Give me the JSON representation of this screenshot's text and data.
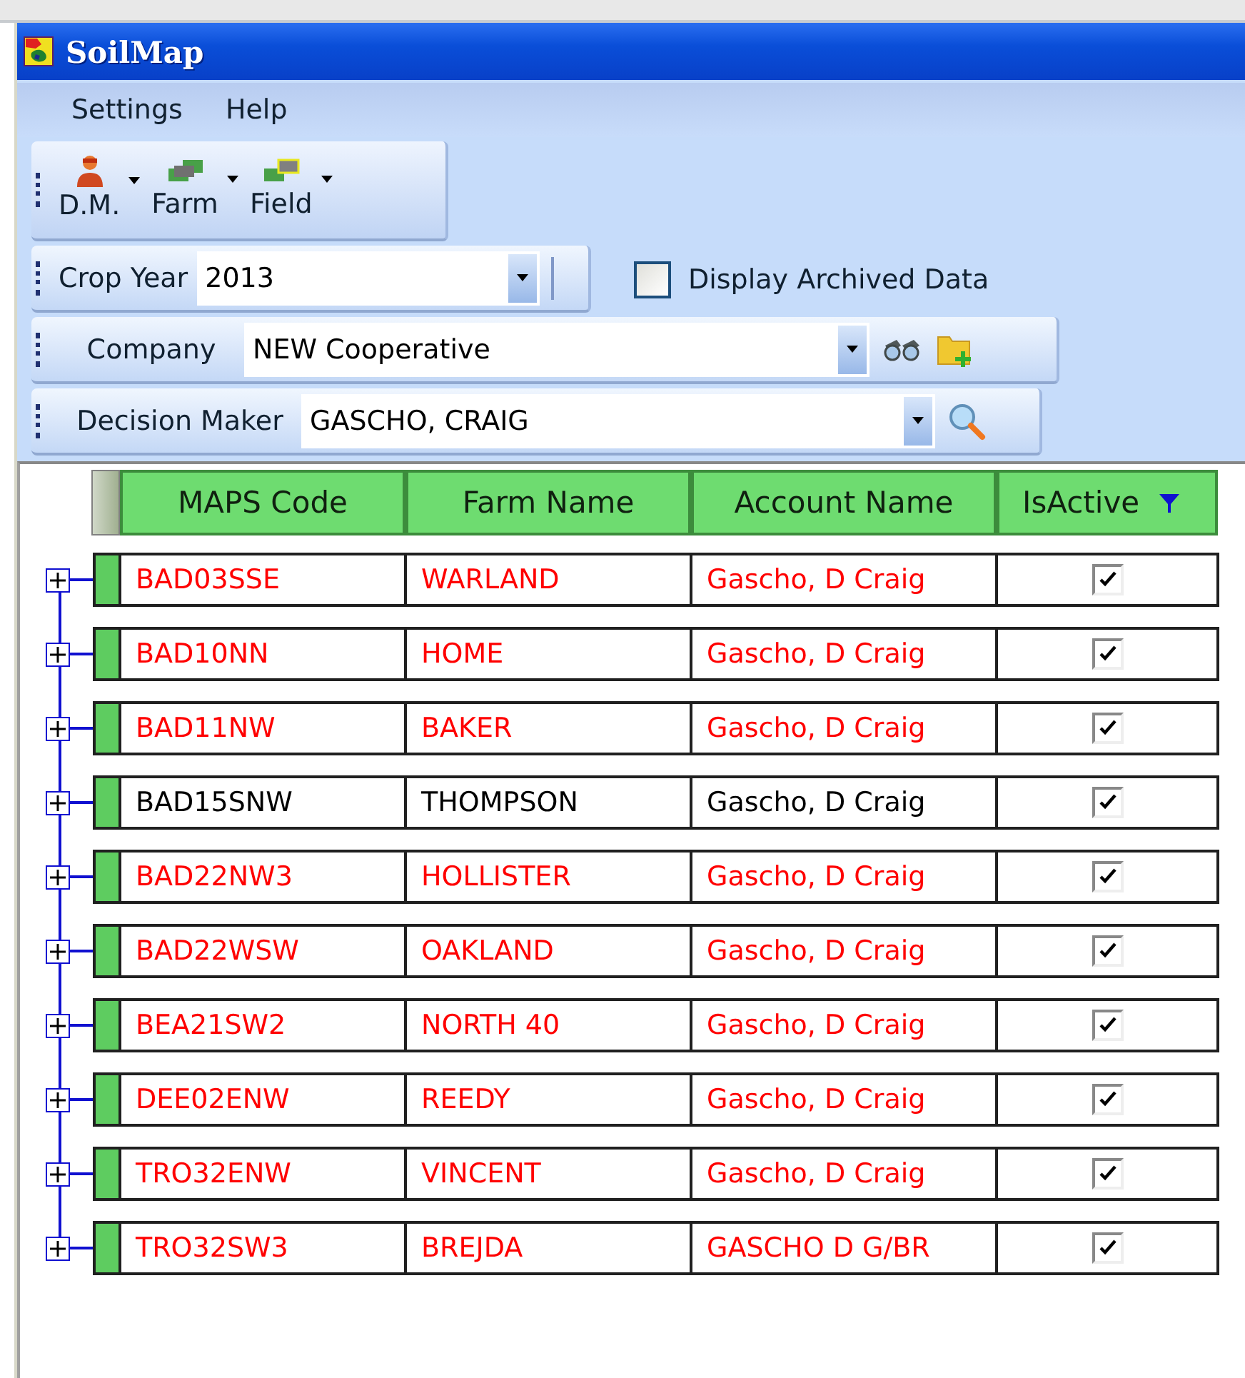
{
  "window": {
    "title": "SoilMap"
  },
  "menu": [
    "Settings",
    "Help"
  ],
  "toolbar": [
    {
      "label": "D.M.",
      "kind": "person"
    },
    {
      "label": "Farm",
      "kind": "farm"
    },
    {
      "label": "Field",
      "kind": "field"
    }
  ],
  "crop_year": {
    "label": "Crop Year",
    "value": "2013"
  },
  "archived": {
    "label": "Display Archived Data",
    "checked": false
  },
  "company": {
    "label": "Company",
    "value": "NEW Cooperative"
  },
  "decision_maker": {
    "label": "Decision Maker",
    "value": "GASCHO, CRAIG"
  },
  "table": {
    "columns": [
      "MAPS Code",
      "Farm Name",
      "Account Name",
      "IsActive"
    ],
    "rows": [
      {
        "cells": [
          "BAD03SSE",
          "WARLAND",
          "Gascho, D Craig"
        ],
        "active": true,
        "expanded": false,
        "color": "#ff0000"
      },
      {
        "cells": [
          "BAD10NN",
          "HOME",
          "Gascho, D Craig"
        ],
        "active": true,
        "expanded": false,
        "color": "#ff0000"
      },
      {
        "cells": [
          "BAD11NW",
          "BAKER",
          "Gascho, D Craig"
        ],
        "active": true,
        "expanded": false,
        "color": "#ff0000"
      },
      {
        "cells": [
          "BAD15SNW",
          "THOMPSON",
          "Gascho, D Craig"
        ],
        "active": true,
        "expanded": false,
        "color": "#000000"
      },
      {
        "cells": [
          "BAD22NW3",
          "HOLLISTER",
          "Gascho, D Craig"
        ],
        "active": true,
        "expanded": false,
        "color": "#ff0000"
      },
      {
        "cells": [
          "BAD22WSW",
          "OAKLAND",
          "Gascho, D Craig"
        ],
        "active": true,
        "expanded": false,
        "color": "#ff0000"
      },
      {
        "cells": [
          "BEA21SW2",
          "NORTH 40",
          "Gascho, D Craig"
        ],
        "active": true,
        "expanded": false,
        "color": "#ff0000"
      },
      {
        "cells": [
          "DEE02ENW",
          "REEDY",
          "Gascho, D Craig"
        ],
        "active": true,
        "expanded": false,
        "color": "#ff0000"
      },
      {
        "cells": [
          "TRO32ENW",
          "VINCENT",
          "Gascho, D Craig"
        ],
        "active": true,
        "expanded": false,
        "color": "#ff0000"
      },
      {
        "cells": [
          "TRO32SW3",
          "BREJDA",
          "GASCHO D G/BR"
        ],
        "active": true,
        "expanded": false,
        "color": "#ff0000"
      }
    ]
  }
}
